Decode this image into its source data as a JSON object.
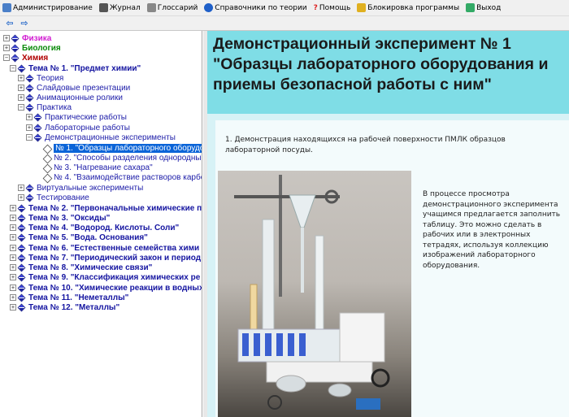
{
  "menubar": {
    "items": [
      {
        "label": "Администрирование",
        "icon": "admin-icon"
      },
      {
        "label": "Журнал",
        "icon": "journal-icon"
      },
      {
        "label": "Глоссарий",
        "icon": "glossary-icon"
      },
      {
        "label": "Справочники по теории",
        "icon": "info-icon"
      },
      {
        "label": "Помощь",
        "icon": "help-icon"
      },
      {
        "label": "Блокировка программы",
        "icon": "lock-icon"
      },
      {
        "label": "Выход",
        "icon": "exit-icon"
      }
    ]
  },
  "toolbar": {
    "back": "⇦",
    "forward": "⇨"
  },
  "tree": {
    "physics": "Физика",
    "biology": "Биология",
    "chemistry": "Химия",
    "topic1": "Тема № 1. \"Предмет химии\"",
    "theory": "Теория",
    "slides": "Слайдовые презентации",
    "animations": "Анимационные ролики",
    "practice": "Практика",
    "practical_works": "Практические работы",
    "lab_works": "Лабораторные работы",
    "demo_experiments": "Демонстрационные эксперименты",
    "demo1": "№ 1. \"Образцы лабораторного оборудо",
    "demo2": "№ 2. \"Способы разделения однородны",
    "demo3": "№ 3. \"Нагревание сахара\"",
    "demo4": "№ 4. \"Взаимодействие растворов карбо",
    "virtual": "Виртуальные эксперименты",
    "testing": "Тестирование",
    "topics": [
      "Тема № 2. \"Первоначальные химические п",
      "Тема № 3. \"Оксиды\"",
      "Тема № 4. \"Водород. Кислоты. Соли\"",
      "Тема № 5. \"Вода. Основания\"",
      "Тема № 6. \"Естественные семейства хими",
      "Тема № 7. \"Периодический закон и период",
      "Тема № 8. \"Химические связи\"",
      "Тема № 9. \"Классификация химических ре",
      "Тема № 10. \"Химические реакции в водных",
      "Тема № 11. \"Неметаллы\"",
      "Тема № 12. \"Металлы\""
    ]
  },
  "content": {
    "title": "Демонстрационный эксперимент № 1 \"Образцы лабораторного оборудования и приемы безопасной работы с ним\"",
    "item_text": "1. Демонстрация находящихся на рабочей поверхности ПМЛК образцов лабораторной посуды.",
    "side_text": "В процессе просмотра демонстрационного эксперимента учащимся предлагается заполнить таблицу. Это можно сделать в рабочих или в электронных тетрадях, используя коллекцию изображений лабораторного оборудования."
  },
  "colors": {
    "header_bg": "#7fdde6",
    "content_bg": "#d7f2f6",
    "selection": "#0a64d8",
    "physics": "#d11bd1",
    "biology": "#0a8a0a",
    "chemistry": "#b00000",
    "topic": "#1414a0"
  }
}
